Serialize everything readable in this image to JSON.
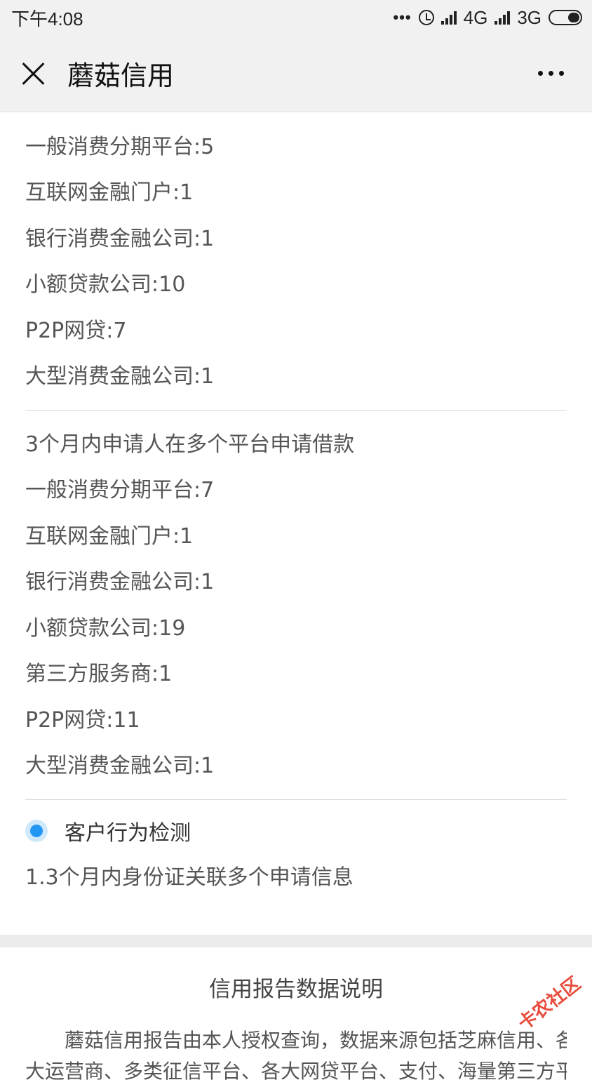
{
  "status_bar": {
    "time": "下午4:08",
    "dots": "•••",
    "network_1": "4G",
    "network_2": "3G"
  },
  "nav": {
    "title": "蘑菇信用"
  },
  "first_list": [
    "一般消费分期平台:5",
    "互联网金融门户:1",
    "银行消费金融公司:1",
    "小额贷款公司:10",
    "P2P网贷:7",
    "大型消费金融公司:1"
  ],
  "second_section": {
    "heading": "3个月内申请人在多个平台申请借款",
    "items": [
      "一般消费分期平台:7",
      "互联网金融门户:1",
      "银行消费金融公司:1",
      "小额贷款公司:19",
      "第三方服务商:1",
      "P2P网贷:11",
      "大型消费金融公司:1"
    ]
  },
  "behavior": {
    "title": "客户行为检测",
    "item": "1.3个月内身份证关联多个申请信息"
  },
  "footer": {
    "title": "信用报告数据说明",
    "text_line1": "蘑菇信用报告由本人授权查询，数据来源包括芝麻信用、各",
    "text_line2": "大运营商、多类征信平台、各大网贷平台、支付、海量第三方平"
  },
  "watermark": "卡农社区"
}
